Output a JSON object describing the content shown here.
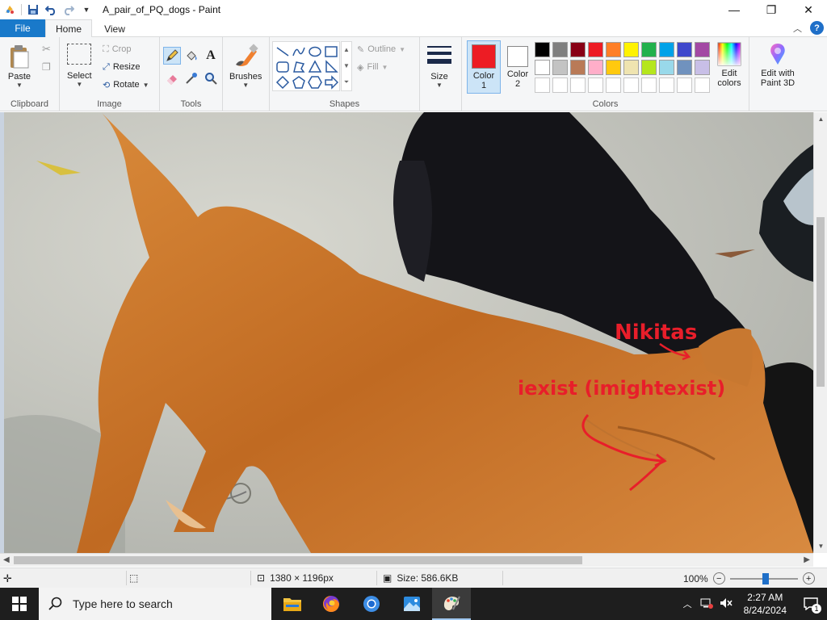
{
  "window": {
    "title": "A_pair_of_PQ_dogs - Paint",
    "minimize": "—",
    "maximize": "❐",
    "close": "✕"
  },
  "menu": {
    "file": "File",
    "home": "Home",
    "view": "View",
    "help": "?"
  },
  "clipboard": {
    "paste": "Paste",
    "label": "Clipboard"
  },
  "image": {
    "select": "Select",
    "crop": "Crop",
    "resize": "Resize",
    "rotate": "Rotate",
    "label": "Image"
  },
  "tools": {
    "label": "Tools"
  },
  "brushes": {
    "label": "Brushes"
  },
  "shapes": {
    "outline": "Outline",
    "fill": "Fill",
    "label": "Shapes"
  },
  "size": {
    "label": "Size"
  },
  "colors": {
    "color1_line1": "Color",
    "color1_line2": "1",
    "color2_line1": "Color",
    "color2_line2": "2",
    "edit_line1": "Edit",
    "edit_line2": "colors",
    "paint3d_line1": "Edit with",
    "paint3d_line2": "Paint 3D",
    "label": "Colors",
    "color1_value": "#ed1c24",
    "color2_value": "#ffffff",
    "palette_row1": [
      "#000000",
      "#7f7f7f",
      "#880015",
      "#ed1c24",
      "#ff7f27",
      "#fff200",
      "#22b14c",
      "#00a2e8",
      "#3f48cc",
      "#a349a4"
    ],
    "palette_row2": [
      "#ffffff",
      "#c3c3c3",
      "#b97a57",
      "#ffaec9",
      "#ffc90e",
      "#efe4b0",
      "#b5e61d",
      "#99d9ea",
      "#7092be",
      "#c8bfe7"
    ]
  },
  "canvas": {
    "annotation1": "Nikitas",
    "annotation2": "iexist (imightexist)"
  },
  "status": {
    "dimensions": "1380 × 1196px",
    "size": "Size: 586.6KB",
    "zoom": "100%"
  },
  "taskbar": {
    "search_placeholder": "Type here to search",
    "time": "2:27 AM",
    "date": "8/24/2024",
    "notification_count": "1"
  }
}
